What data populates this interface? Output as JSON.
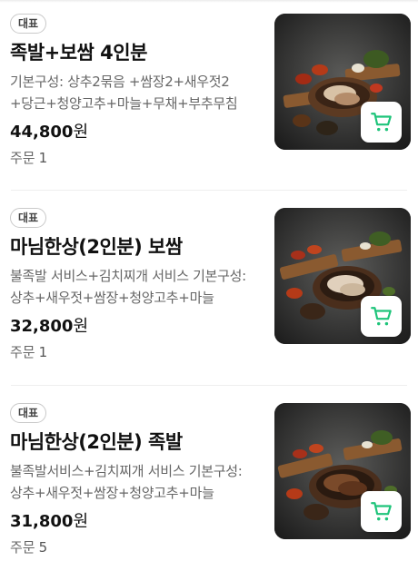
{
  "menu_items": [
    {
      "badge": "대표",
      "title": "족발+보쌈 4인분",
      "description": "기본구성: 상추2묶음 +쌈장2+새우젓2+당근+청양고추+마늘+무채+부추무침",
      "price": "44,800",
      "price_unit": "원",
      "orders_label": "주문",
      "orders_count": "1",
      "image_icon": "food-photo-icon",
      "cart_icon": "cart-icon",
      "cart_color": "#1ec47a"
    },
    {
      "badge": "대표",
      "title": "마님한상(2인분) 보쌈",
      "description": "불족발 서비스+김치찌개 서비스 기본구성: 상추+새우젓+쌈장+청양고추+마늘",
      "price": "32,800",
      "price_unit": "원",
      "orders_label": "주문",
      "orders_count": "1",
      "image_icon": "food-photo-icon",
      "cart_icon": "cart-icon",
      "cart_color": "#1ec47a"
    },
    {
      "badge": "대표",
      "title": "마님한상(2인분) 족발",
      "description": "불족발서비스+김치찌개 서비스 기본구성: 상추+새우젓+쌈장+청양고추+마늘",
      "price": "31,800",
      "price_unit": "원",
      "orders_label": "주문",
      "orders_count": "5",
      "image_icon": "food-photo-icon",
      "cart_icon": "cart-icon",
      "cart_color": "#1ec47a"
    }
  ]
}
